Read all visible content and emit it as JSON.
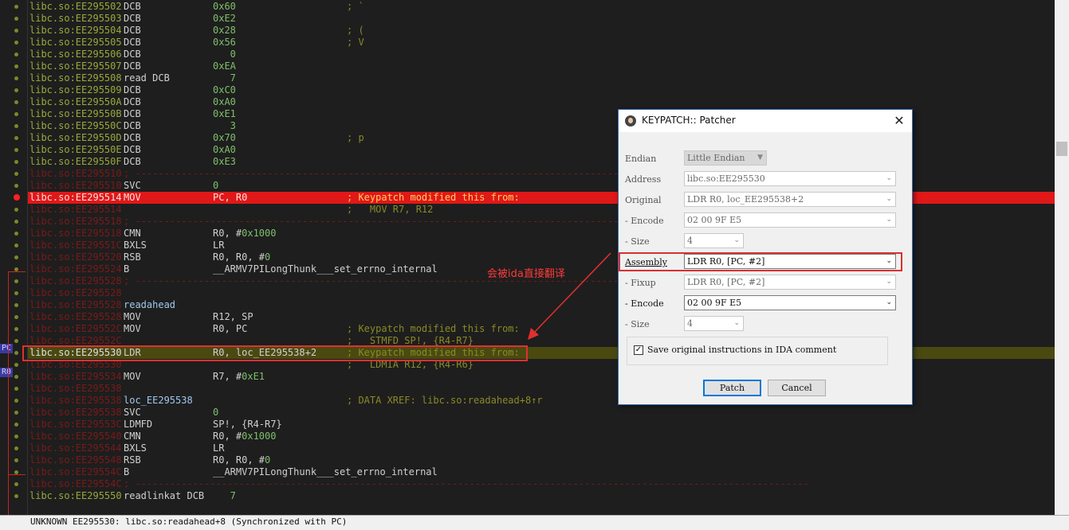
{
  "colors": {
    "highlight_red": "#e01818",
    "highlight_olive": "#4a4a10",
    "annotation": "#e03030"
  },
  "listing": [
    {
      "addr": "libc.so:EE295502",
      "mn": "DCB",
      "op": "",
      "num": "0x60",
      "cm": "; `",
      "tone": "g"
    },
    {
      "addr": "libc.so:EE295503",
      "mn": "DCB",
      "op": "",
      "num": "0xE2",
      "cm": "",
      "tone": "g"
    },
    {
      "addr": "libc.so:EE295504",
      "mn": "DCB",
      "op": "",
      "num": "0x28",
      "cm": "; (",
      "tone": "g"
    },
    {
      "addr": "libc.so:EE295505",
      "mn": "DCB",
      "op": "",
      "num": "0x56",
      "cm": "; V",
      "tone": "g"
    },
    {
      "addr": "libc.so:EE295506",
      "mn": "DCB",
      "op": "",
      "num": "   0",
      "cm": "",
      "tone": "g"
    },
    {
      "addr": "libc.so:EE295507",
      "mn": "DCB",
      "op": "",
      "num": "0xEA",
      "cm": "",
      "tone": "g"
    },
    {
      "addr": "libc.so:EE295508",
      "mn": "read DCB",
      "op": "",
      "num": "   7",
      "cm": "",
      "tone": "g"
    },
    {
      "addr": "libc.so:EE295509",
      "mn": "DCB",
      "op": "",
      "num": "0xC0",
      "cm": "",
      "tone": "g"
    },
    {
      "addr": "libc.so:EE29550A",
      "mn": "DCB",
      "op": "",
      "num": "0xA0",
      "cm": "",
      "tone": "g"
    },
    {
      "addr": "libc.so:EE29550B",
      "mn": "DCB",
      "op": "",
      "num": "0xE1",
      "cm": "",
      "tone": "g"
    },
    {
      "addr": "libc.so:EE29550C",
      "mn": "DCB",
      "op": "",
      "num": "   3",
      "cm": "",
      "tone": "g"
    },
    {
      "addr": "libc.so:EE29550D",
      "mn": "DCB",
      "op": "",
      "num": "0x70",
      "cm": "; p",
      "tone": "g"
    },
    {
      "addr": "libc.so:EE29550E",
      "mn": "DCB",
      "op": "",
      "num": "0xA0",
      "cm": "",
      "tone": "g"
    },
    {
      "addr": "libc.so:EE29550F",
      "mn": "DCB",
      "op": "",
      "num": "0xE3",
      "cm": "",
      "tone": "g"
    },
    {
      "addr": "libc.so:EE295510",
      "mn": "; ---------------------------------------------------------------------------------------------------------------------",
      "op": "",
      "num": "",
      "cm": "",
      "tone": "r",
      "sep": true
    },
    {
      "addr": "libc.so:EE295510",
      "mn": "SVC",
      "op": "",
      "num": "0",
      "cm": "",
      "tone": "r"
    },
    {
      "addr": "libc.so:EE295514",
      "mn": "MOV",
      "op": "PC, R0",
      "num": "",
      "cm": "; Keypatch modified this from:",
      "tone": "r",
      "hl": "red"
    },
    {
      "addr": "libc.so:EE295514",
      "mn": "",
      "op": "",
      "num": "",
      "cm": ";   MOV R7, R12",
      "tone": "r"
    },
    {
      "addr": "libc.so:EE295518",
      "mn": "; ---------------------------------------------------------------------------------------------------------------------",
      "op": "",
      "num": "",
      "cm": "",
      "tone": "r",
      "sep": true
    },
    {
      "addr": "libc.so:EE295518",
      "mn": "CMN",
      "op": "R0, #",
      "num": "0x1000",
      "cm": "",
      "tone": "r"
    },
    {
      "addr": "libc.so:EE29551C",
      "mn": "BXLS",
      "op": "LR",
      "num": "",
      "cm": "",
      "tone": "r"
    },
    {
      "addr": "libc.so:EE295520",
      "mn": "RSB",
      "op": "R0, R0, #",
      "num": "0",
      "cm": "",
      "tone": "r"
    },
    {
      "addr": "libc.so:EE295524",
      "mn": "B",
      "op": "__ARMV7PILongThunk___set_errno_internal",
      "num": "",
      "cm": "",
      "tone": "r"
    },
    {
      "addr": "libc.so:EE295528",
      "mn": "; ---------------------------------------------------------------------------------------------------------------------",
      "op": "",
      "num": "",
      "cm": "",
      "tone": "r",
      "sep": true
    },
    {
      "addr": "libc.so:EE295528",
      "mn": "",
      "op": "",
      "num": "",
      "cm": "",
      "tone": "r"
    },
    {
      "addr": "libc.so:EE295528",
      "mn": "readahead",
      "op": "",
      "num": "",
      "cm": "",
      "tone": "r",
      "label": true
    },
    {
      "addr": "libc.so:EE295528",
      "mn": "MOV",
      "op": "R12, SP",
      "num": "",
      "cm": "",
      "tone": "r"
    },
    {
      "addr": "libc.so:EE29552C",
      "mn": "MOV",
      "op": "R0, PC",
      "num": "",
      "cm": "; Keypatch modified this from:",
      "tone": "r"
    },
    {
      "addr": "libc.so:EE29552C",
      "mn": "",
      "op": "",
      "num": "",
      "cm": ";   STMFD SP!, {R4-R7}",
      "tone": "r"
    },
    {
      "addr": "libc.so:EE295530",
      "mn": "LDR",
      "op": "R0, loc_EE295538+2",
      "num": "",
      "cm": "; Keypatch modified this from:",
      "tone": "w",
      "hl": "olive"
    },
    {
      "addr": "libc.so:EE295530",
      "mn": "",
      "op": "",
      "num": "",
      "cm": ";   LDMIA R12, {R4-R6}",
      "tone": "r"
    },
    {
      "addr": "libc.so:EE295534",
      "mn": "MOV",
      "op": "R7, #",
      "num": "0xE1",
      "cm": "",
      "tone": "r"
    },
    {
      "addr": "libc.so:EE295538",
      "mn": "",
      "op": "",
      "num": "",
      "cm": "",
      "tone": "r"
    },
    {
      "addr": "libc.so:EE295538",
      "mn": "loc_EE295538",
      "op": "",
      "num": "",
      "cm": "; DATA XREF: libc.so:readahead+8↑r",
      "tone": "r",
      "label": true
    },
    {
      "addr": "libc.so:EE295538",
      "mn": "SVC",
      "op": "",
      "num": "0",
      "cm": "",
      "tone": "r"
    },
    {
      "addr": "libc.so:EE29553C",
      "mn": "LDMFD",
      "op": "SP!, {R4-R7}",
      "num": "",
      "cm": "",
      "tone": "r"
    },
    {
      "addr": "libc.so:EE295540",
      "mn": "CMN",
      "op": "R0, #",
      "num": "0x1000",
      "cm": "",
      "tone": "r"
    },
    {
      "addr": "libc.so:EE295544",
      "mn": "BXLS",
      "op": "LR",
      "num": "",
      "cm": "",
      "tone": "r"
    },
    {
      "addr": "libc.so:EE295548",
      "mn": "RSB",
      "op": "R0, R0, #",
      "num": "0",
      "cm": "",
      "tone": "r"
    },
    {
      "addr": "libc.so:EE29554C",
      "mn": "B",
      "op": "__ARMV7PILongThunk___set_errno_internal",
      "num": "",
      "cm": "",
      "tone": "r"
    },
    {
      "addr": "libc.so:EE29554C",
      "mn": "; ---------------------------------------------------------------------------------------------------------------------",
      "op": "",
      "num": "",
      "cm": "",
      "tone": "r",
      "sep": true
    },
    {
      "addr": "libc.so:EE295550",
      "mn": "readlinkat DCB",
      "op": "",
      "num": "   7",
      "cm": "",
      "tone": "g"
    }
  ],
  "gutter": {
    "pc_label": "PC",
    "r0_label": "R0"
  },
  "annotation": {
    "text": "会被ida直接翻译"
  },
  "status": {
    "text": "UNKNOWN EE295530: libc.so:readahead+8 (Synchronized with PC)"
  },
  "dialog": {
    "title": "KEYPATCH:: Patcher",
    "close_glyph": "✕",
    "fields": {
      "endian": {
        "label": "Endian",
        "value": "Little Endian"
      },
      "address": {
        "label": "Address",
        "value": "libc.so:EE295530"
      },
      "original": {
        "label": "Original",
        "value": "LDR R0, loc_EE295538+2"
      },
      "encode1": {
        "label": "-   Encode",
        "value": "02 00 9F E5"
      },
      "size1": {
        "label": "-   Size",
        "value": "4"
      },
      "assembly": {
        "label": "Assembly",
        "value": "LDR R0, [PC, #2]"
      },
      "fixup": {
        "label": "-   Fixup",
        "value": "LDR R0, [PC, #2]"
      },
      "encode2": {
        "label": "-   Encode",
        "value": "02 00 9F E5"
      },
      "size2": {
        "label": "-   Size",
        "value": "4"
      }
    },
    "checkbox": {
      "label": "Save original instructions in IDA comment",
      "checked": true,
      "mark": "✓"
    },
    "buttons": {
      "patch": "Patch",
      "cancel": "Cancel"
    }
  }
}
